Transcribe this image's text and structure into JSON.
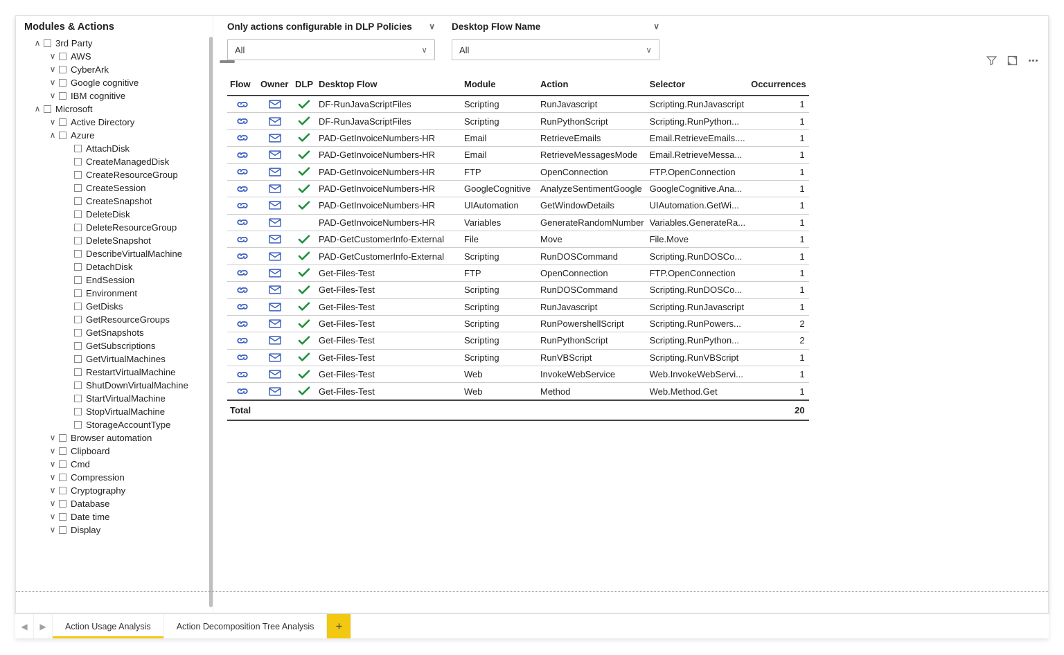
{
  "treeTitle": "Modules & Actions",
  "tree": [
    {
      "lvl": 0,
      "arrow": "open",
      "label": "3rd Party"
    },
    {
      "lvl": 1,
      "arrow": "closed",
      "label": "AWS"
    },
    {
      "lvl": 1,
      "arrow": "closed",
      "label": "CyberArk"
    },
    {
      "lvl": 1,
      "arrow": "closed",
      "label": "Google cognitive"
    },
    {
      "lvl": 1,
      "arrow": "closed",
      "label": "IBM cognitive"
    },
    {
      "lvl": 0,
      "arrow": "open",
      "label": "Microsoft"
    },
    {
      "lvl": 1,
      "arrow": "closed",
      "label": "Active Directory"
    },
    {
      "lvl": 1,
      "arrow": "open",
      "label": "Azure"
    },
    {
      "lvl": 2,
      "arrow": "blank",
      "label": "AttachDisk"
    },
    {
      "lvl": 2,
      "arrow": "blank",
      "label": "CreateManagedDisk"
    },
    {
      "lvl": 2,
      "arrow": "blank",
      "label": "CreateResourceGroup"
    },
    {
      "lvl": 2,
      "arrow": "blank",
      "label": "CreateSession"
    },
    {
      "lvl": 2,
      "arrow": "blank",
      "label": "CreateSnapshot"
    },
    {
      "lvl": 2,
      "arrow": "blank",
      "label": "DeleteDisk"
    },
    {
      "lvl": 2,
      "arrow": "blank",
      "label": "DeleteResourceGroup"
    },
    {
      "lvl": 2,
      "arrow": "blank",
      "label": "DeleteSnapshot"
    },
    {
      "lvl": 2,
      "arrow": "blank",
      "label": "DescribeVirtualMachine"
    },
    {
      "lvl": 2,
      "arrow": "blank",
      "label": "DetachDisk"
    },
    {
      "lvl": 2,
      "arrow": "blank",
      "label": "EndSession"
    },
    {
      "lvl": 2,
      "arrow": "blank",
      "label": "Environment"
    },
    {
      "lvl": 2,
      "arrow": "blank",
      "label": "GetDisks"
    },
    {
      "lvl": 2,
      "arrow": "blank",
      "label": "GetResourceGroups"
    },
    {
      "lvl": 2,
      "arrow": "blank",
      "label": "GetSnapshots"
    },
    {
      "lvl": 2,
      "arrow": "blank",
      "label": "GetSubscriptions"
    },
    {
      "lvl": 2,
      "arrow": "blank",
      "label": "GetVirtualMachines"
    },
    {
      "lvl": 2,
      "arrow": "blank",
      "label": "RestartVirtualMachine"
    },
    {
      "lvl": 2,
      "arrow": "blank",
      "label": "ShutDownVirtualMachine"
    },
    {
      "lvl": 2,
      "arrow": "blank",
      "label": "StartVirtualMachine"
    },
    {
      "lvl": 2,
      "arrow": "blank",
      "label": "StopVirtualMachine"
    },
    {
      "lvl": 2,
      "arrow": "blank",
      "label": "StorageAccountType"
    },
    {
      "lvl": 1,
      "arrow": "closed",
      "label": "Browser automation"
    },
    {
      "lvl": 1,
      "arrow": "closed",
      "label": "Clipboard"
    },
    {
      "lvl": 1,
      "arrow": "closed",
      "label": "Cmd"
    },
    {
      "lvl": 1,
      "arrow": "closed",
      "label": "Compression"
    },
    {
      "lvl": 1,
      "arrow": "closed",
      "label": "Cryptography"
    },
    {
      "lvl": 1,
      "arrow": "closed",
      "label": "Database"
    },
    {
      "lvl": 1,
      "arrow": "closed",
      "label": "Date time"
    },
    {
      "lvl": 1,
      "arrow": "closed",
      "label": "Display"
    }
  ],
  "slicers": {
    "dlp": {
      "title": "Only actions configurable in DLP Policies",
      "value": "All"
    },
    "flow": {
      "title": "Desktop Flow Name",
      "value": "All"
    }
  },
  "columns": {
    "flow": "Flow",
    "owner": "Owner",
    "dlp": "DLP",
    "desktopFlow": "Desktop Flow",
    "module": "Module",
    "action": "Action",
    "selector": "Selector",
    "occ": "Occurrences"
  },
  "rows": [
    {
      "dlp": true,
      "df": "DF-RunJavaScriptFiles",
      "mod": "Scripting",
      "act": "RunJavascript",
      "sel": "Scripting.RunJavascript",
      "occ": 1
    },
    {
      "dlp": true,
      "df": "DF-RunJavaScriptFiles",
      "mod": "Scripting",
      "act": "RunPythonScript",
      "sel": "Scripting.RunPython...",
      "occ": 1
    },
    {
      "dlp": true,
      "df": "PAD-GetInvoiceNumbers-HR",
      "mod": "Email",
      "act": "RetrieveEmails",
      "sel": "Email.RetrieveEmails....",
      "occ": 1
    },
    {
      "dlp": true,
      "df": "PAD-GetInvoiceNumbers-HR",
      "mod": "Email",
      "act": "RetrieveMessagesMode",
      "sel": "Email.RetrieveMessa...",
      "occ": 1
    },
    {
      "dlp": true,
      "df": "PAD-GetInvoiceNumbers-HR",
      "mod": "FTP",
      "act": "OpenConnection",
      "sel": "FTP.OpenConnection",
      "occ": 1
    },
    {
      "dlp": true,
      "df": "PAD-GetInvoiceNumbers-HR",
      "mod": "GoogleCognitive",
      "act": "AnalyzeSentimentGoogle",
      "sel": "GoogleCognitive.Ana...",
      "occ": 1
    },
    {
      "dlp": true,
      "df": "PAD-GetInvoiceNumbers-HR",
      "mod": "UIAutomation",
      "act": "GetWindowDetails",
      "sel": "UIAutomation.GetWi...",
      "occ": 1
    },
    {
      "dlp": false,
      "df": "PAD-GetInvoiceNumbers-HR",
      "mod": "Variables",
      "act": "GenerateRandomNumber",
      "sel": "Variables.GenerateRa...",
      "occ": 1
    },
    {
      "dlp": true,
      "df": "PAD-GetCustomerInfo-External",
      "mod": "File",
      "act": "Move",
      "sel": "File.Move",
      "occ": 1
    },
    {
      "dlp": true,
      "df": "PAD-GetCustomerInfo-External",
      "mod": "Scripting",
      "act": "RunDOSCommand",
      "sel": "Scripting.RunDOSCo...",
      "occ": 1
    },
    {
      "dlp": true,
      "df": "Get-Files-Test",
      "mod": "FTP",
      "act": "OpenConnection",
      "sel": "FTP.OpenConnection",
      "occ": 1
    },
    {
      "dlp": true,
      "df": "Get-Files-Test",
      "mod": "Scripting",
      "act": "RunDOSCommand",
      "sel": "Scripting.RunDOSCo...",
      "occ": 1
    },
    {
      "dlp": true,
      "df": "Get-Files-Test",
      "mod": "Scripting",
      "act": "RunJavascript",
      "sel": "Scripting.RunJavascript",
      "occ": 1
    },
    {
      "dlp": true,
      "df": "Get-Files-Test",
      "mod": "Scripting",
      "act": "RunPowershellScript",
      "sel": "Scripting.RunPowers...",
      "occ": 2
    },
    {
      "dlp": true,
      "df": "Get-Files-Test",
      "mod": "Scripting",
      "act": "RunPythonScript",
      "sel": "Scripting.RunPython...",
      "occ": 2
    },
    {
      "dlp": true,
      "df": "Get-Files-Test",
      "mod": "Scripting",
      "act": "RunVBScript",
      "sel": "Scripting.RunVBScript",
      "occ": 1
    },
    {
      "dlp": true,
      "df": "Get-Files-Test",
      "mod": "Web",
      "act": "InvokeWebService",
      "sel": "Web.InvokeWebServi...",
      "occ": 1
    },
    {
      "dlp": true,
      "df": "Get-Files-Test",
      "mod": "Web",
      "act": "Method",
      "sel": "Web.Method.Get",
      "occ": 1
    }
  ],
  "total": {
    "label": "Total",
    "value": 20
  },
  "tabs": {
    "active": "Action Usage Analysis",
    "other": "Action Decomposition Tree Analysis"
  }
}
